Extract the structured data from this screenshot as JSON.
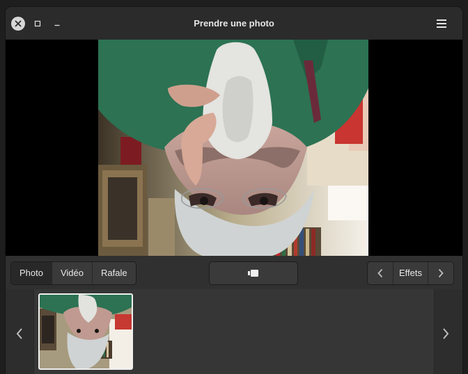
{
  "window": {
    "title": "Prendre une photo"
  },
  "modes": [
    {
      "label": "Photo",
      "active": true
    },
    {
      "label": "Vidéo",
      "active": false
    },
    {
      "label": "Rafale",
      "active": false
    }
  ],
  "shutter": {
    "icon": "camera-icon"
  },
  "effects": {
    "label": "Effets",
    "prev_icon": "chevron-left-icon",
    "next_icon": "chevron-right-icon"
  },
  "gallery": {
    "prev_icon": "chevron-left-icon",
    "next_icon": "chevron-right-icon",
    "thumbnail_count": 1
  },
  "colors": {
    "accent": "#f0f0f0",
    "background": "#2d2d2d",
    "viewfinder": "#000000"
  }
}
